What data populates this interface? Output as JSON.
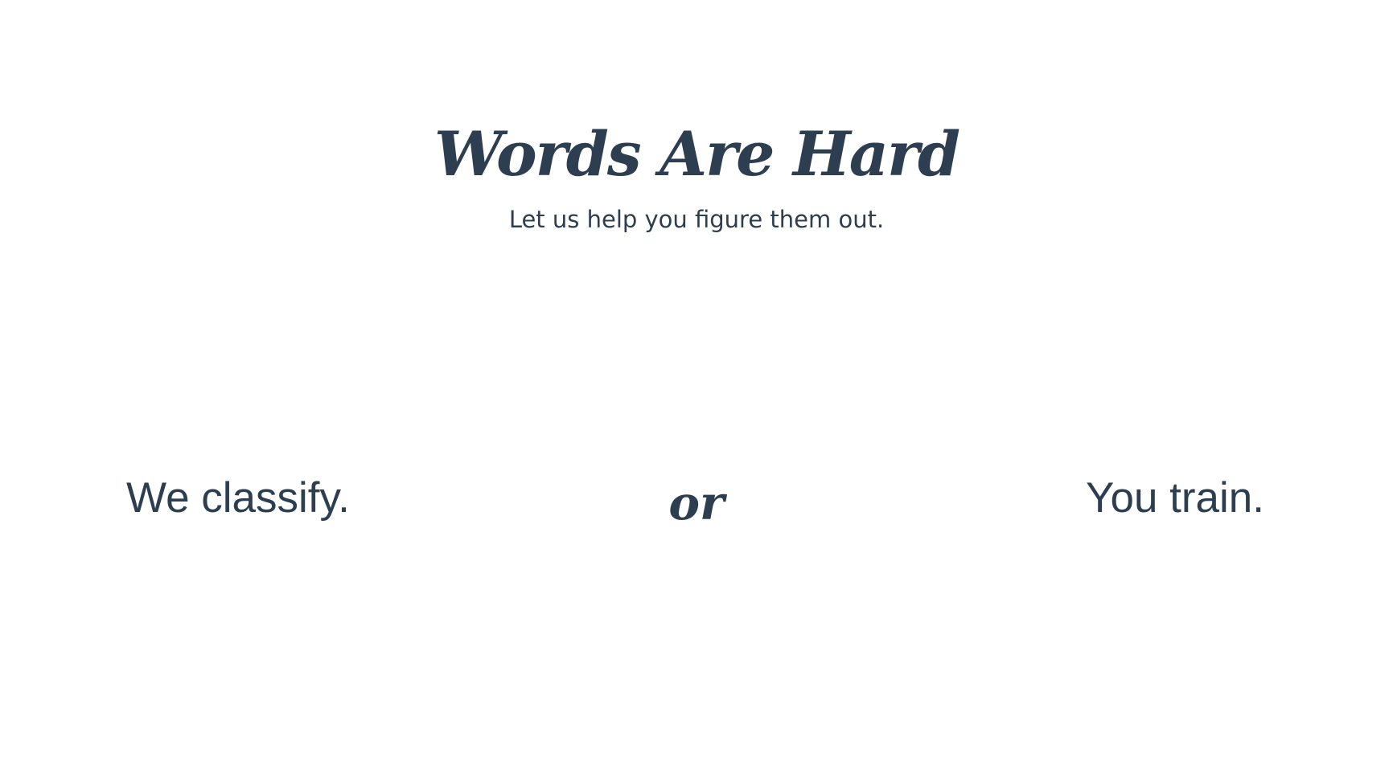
{
  "header": {
    "title": "Words Are Hard",
    "tagline": "Let us help you figure them out."
  },
  "options": {
    "classify_label": "We classify.",
    "divider_text": "or",
    "train_label": "You train."
  },
  "theme": {
    "text_color": "#2c3e50",
    "background": "#ffffff"
  }
}
